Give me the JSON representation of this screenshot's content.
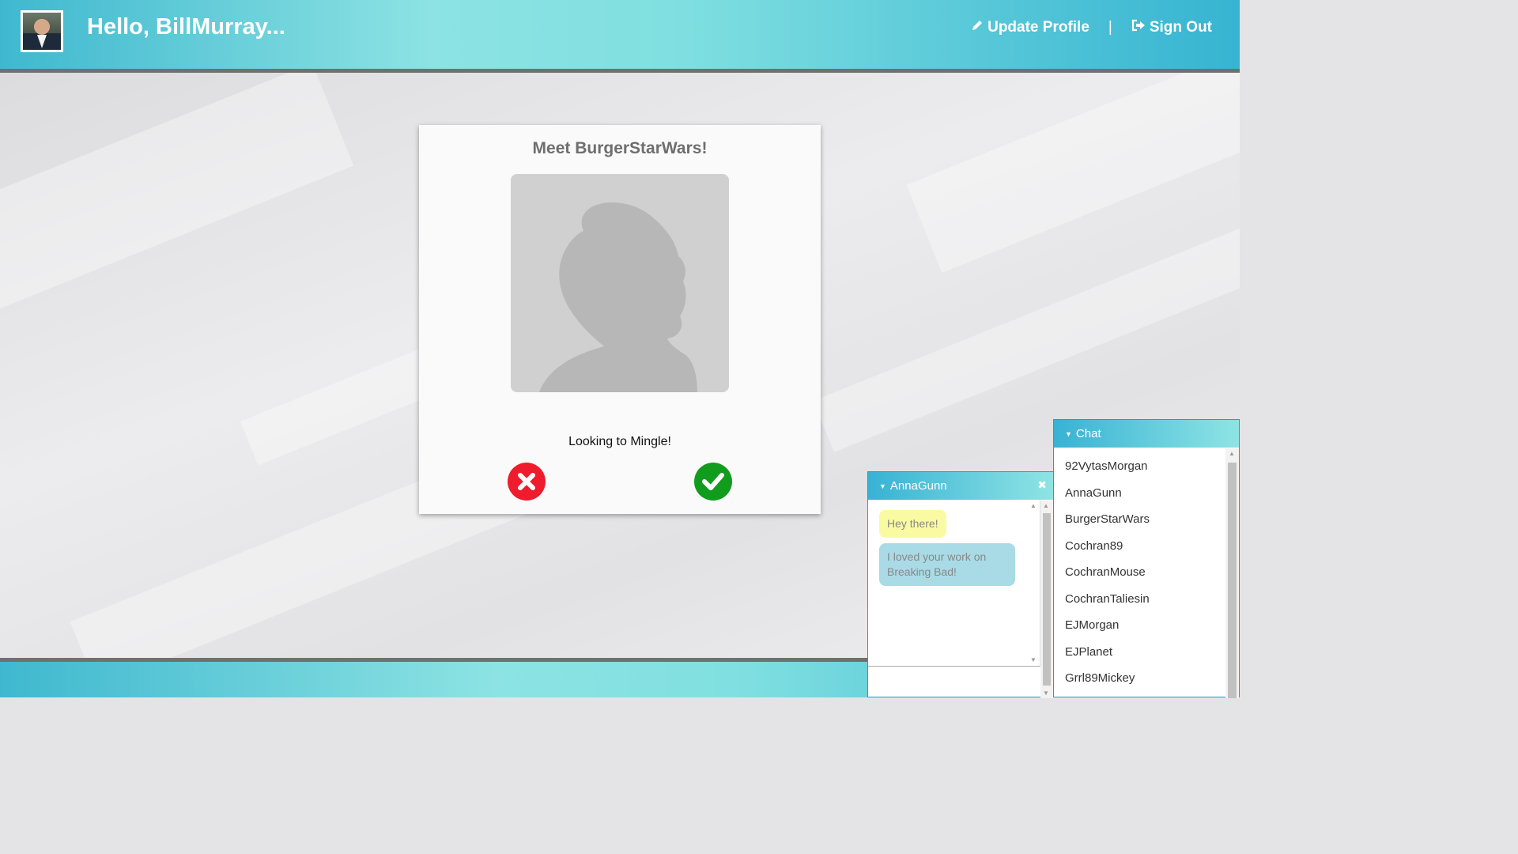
{
  "header": {
    "greeting": "Hello, BillMurray...",
    "update_profile": "Update Profile",
    "separator": "|",
    "sign_out": "Sign Out",
    "icons": {
      "update_profile": "pencil-icon",
      "sign_out": "sign-out-icon"
    }
  },
  "match": {
    "title": "Meet BurgerStarWars!",
    "status": "Looking to Mingle!",
    "reject_icon": "x-icon",
    "accept_icon": "check-icon"
  },
  "conversation": {
    "name": "AnnaGunn",
    "messages": [
      {
        "text": "Hey there!",
        "direction": "incoming"
      },
      {
        "text": "I loved your work on Breaking Bad!",
        "direction": "outgoing"
      }
    ],
    "input_value": ""
  },
  "chat": {
    "title": "Chat",
    "users": [
      "92VytasMorgan",
      "AnnaGunn",
      "BurgerStarWars",
      "Cochran89",
      "CochranMouse",
      "CochranTaliesin",
      "EJMorgan",
      "EJPlanet",
      "Grrl89Mickey"
    ]
  },
  "colors": {
    "accent": "#3fb8cf",
    "reject": "#ee1c2c",
    "accept": "#129c1e",
    "incoming_bubble": "#fafaa2",
    "outgoing_bubble": "#a8dbe6"
  }
}
